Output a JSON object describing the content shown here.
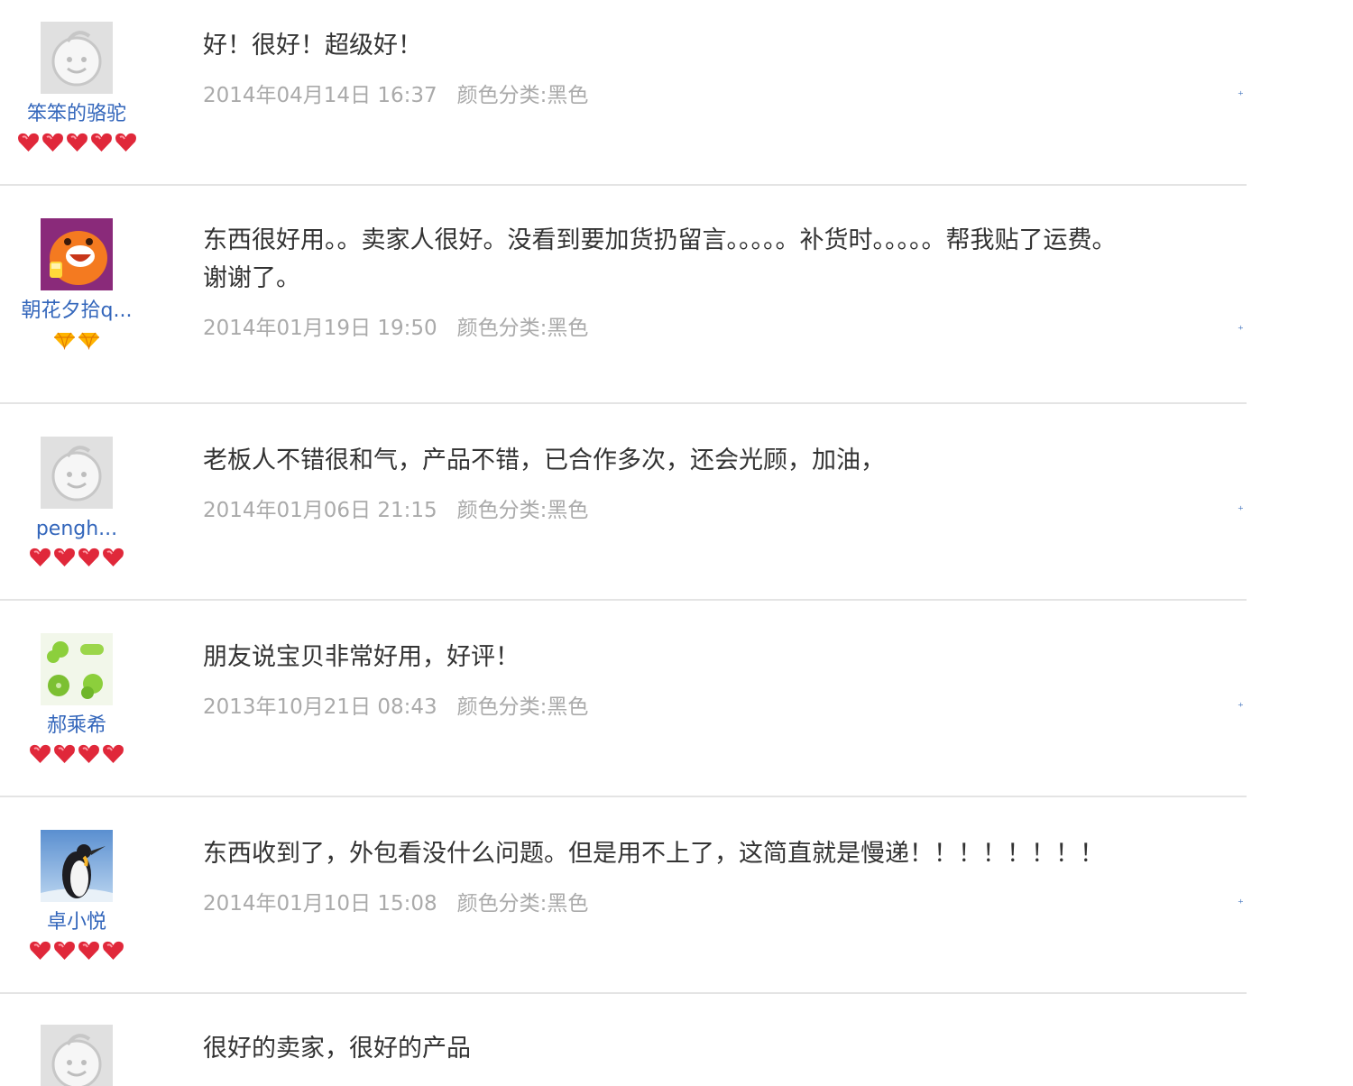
{
  "colors": {
    "nickname": "#3366bb",
    "meta": "#aaaaaa",
    "comment": "#333333",
    "separator": "#e4e4e4",
    "heart_badge": "#e0283a",
    "diamond_badge": "#ffb400"
  },
  "reviews": [
    {
      "nickname": "笨笨的骆驼",
      "avatar": "default-avatar-icon",
      "badge_icon": "red-heart-icon",
      "badge_count": 5,
      "comment": "好！很好！超级好！",
      "date": "2014年04月14日 16:37",
      "sku": "颜色分类:黑色"
    },
    {
      "nickname": "朝花夕拾q...",
      "avatar": "orange-cartoon-avatar-icon",
      "badge_icon": "yellow-diamond-icon",
      "badge_count": 2,
      "comment": "东西很好用。。卖家人很好。没看到要加货扔留言。。。。。补货时。。。。。帮我贴了运费。\n谢谢了。",
      "date": "2014年01月19日 19:50",
      "sku": "颜色分类:黑色"
    },
    {
      "nickname": "pengh...",
      "avatar": "default-avatar-icon",
      "badge_icon": "red-heart-icon",
      "badge_count": 4,
      "comment": "老板人不错很和气，产品不错，已合作多次，还会光顾，加油，",
      "date": "2014年01月06日 21:15",
      "sku": "颜色分类:黑色"
    },
    {
      "nickname": "郝乘希",
      "avatar": "green-clover-avatar-icon",
      "badge_icon": "red-heart-icon",
      "badge_count": 4,
      "comment": "朋友说宝贝非常好用，好评！",
      "date": "2013年10月21日 08:43",
      "sku": "颜色分类:黑色"
    },
    {
      "nickname": "卓小悦",
      "avatar": "penguin-avatar-icon",
      "badge_icon": "red-heart-icon",
      "badge_count": 4,
      "comment": "东西收到了，外包看没什么问题。但是用不上了，这简直就是慢递！！！！！！！！",
      "date": "2014年01月10日 15:08",
      "sku": "颜色分类:黑色"
    },
    {
      "nickname": "",
      "avatar": "default-avatar-icon",
      "badge_icon": "",
      "badge_count": 0,
      "comment": "很好的卖家，很好的产品",
      "date": "",
      "sku": ""
    }
  ]
}
